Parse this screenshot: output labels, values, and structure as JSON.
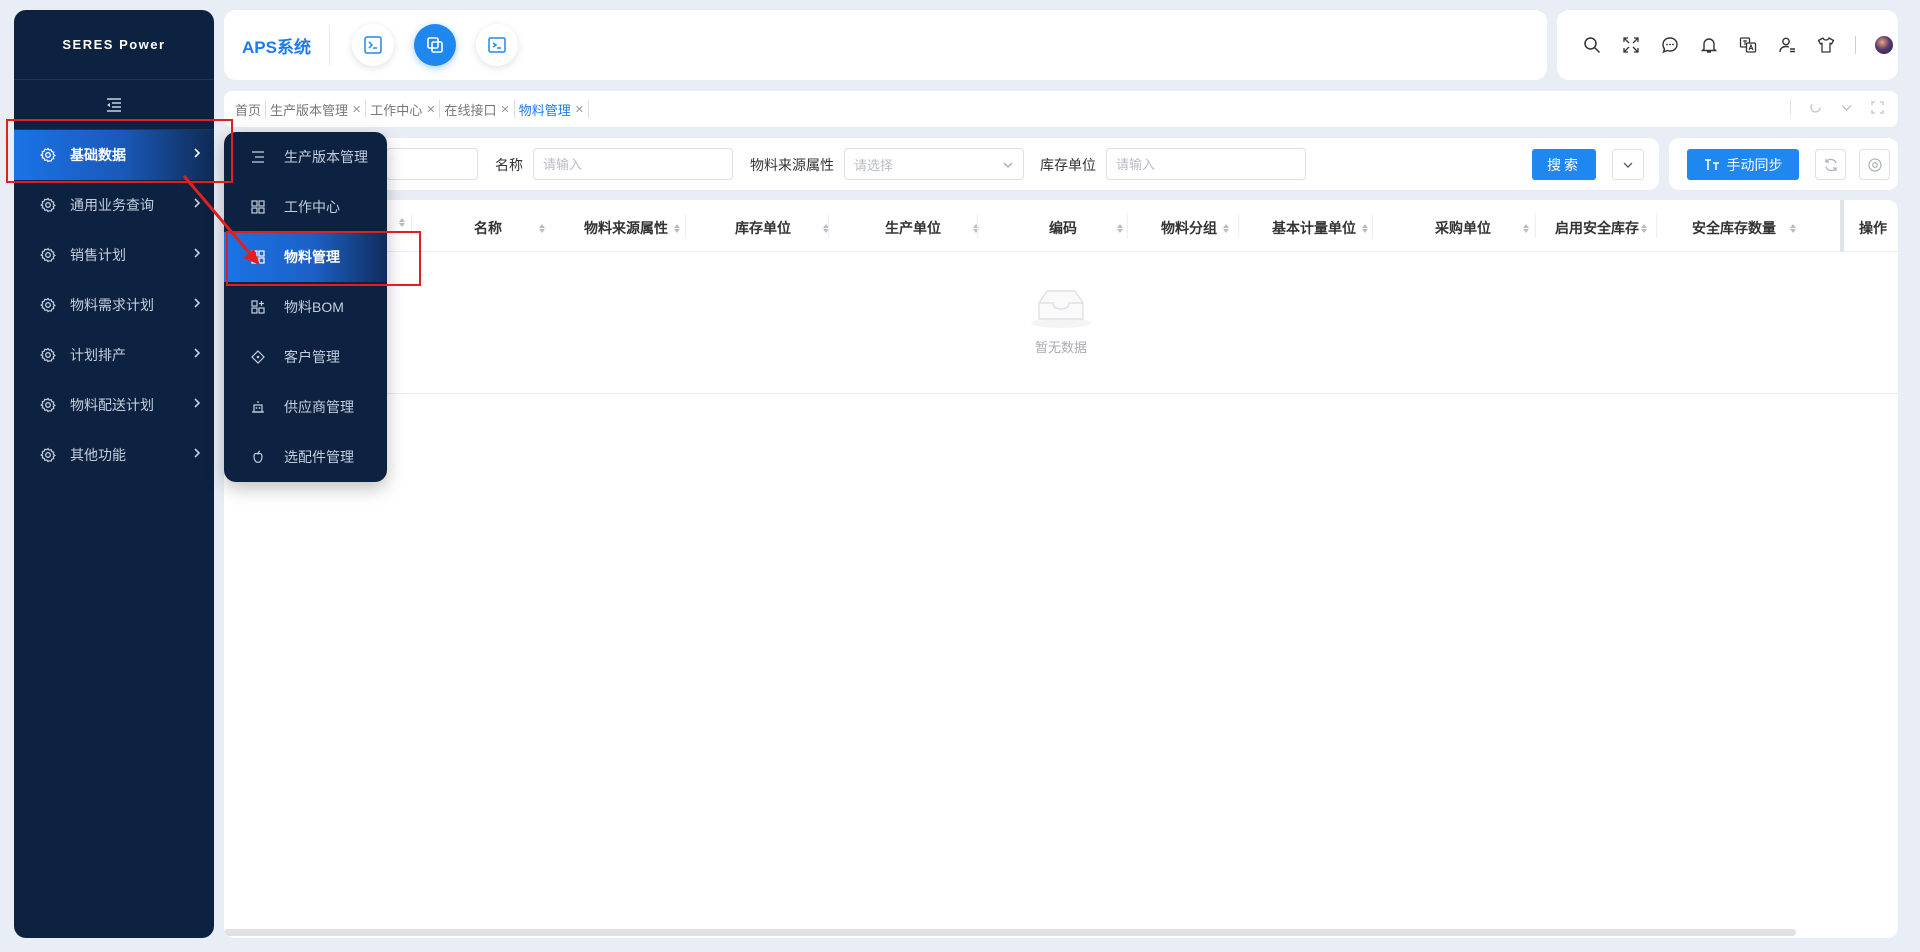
{
  "brand": {
    "logo_text": "SERES Power",
    "app_title": "APS系统"
  },
  "sidebar": {
    "items": [
      {
        "label": "基础数据",
        "icon": "gear-icon",
        "active": true
      },
      {
        "label": "通用业务查询",
        "icon": "gear-icon"
      },
      {
        "label": "销售计划",
        "icon": "gear-icon"
      },
      {
        "label": "物料需求计划",
        "icon": "gear-icon"
      },
      {
        "label": "计划排产",
        "icon": "gear-icon"
      },
      {
        "label": "物料配送计划",
        "icon": "gear-icon"
      },
      {
        "label": "其他功能",
        "icon": "gear-icon"
      }
    ]
  },
  "submenu": {
    "items": [
      {
        "label": "生产版本管理",
        "icon": "list-icon"
      },
      {
        "label": "工作中心",
        "icon": "grid-icon"
      },
      {
        "label": "物料管理",
        "icon": "grid-icon",
        "active": true
      },
      {
        "label": "物料BOM",
        "icon": "grid-plus-icon"
      },
      {
        "label": "客户管理",
        "icon": "diamond-icon"
      },
      {
        "label": "供应商管理",
        "icon": "robot-icon"
      },
      {
        "label": "选配件管理",
        "icon": "apple-icon"
      }
    ]
  },
  "tabs": [
    {
      "label": "首页",
      "closable": false
    },
    {
      "label": "生产版本管理",
      "closable": true
    },
    {
      "label": "工作中心",
      "closable": true
    },
    {
      "label": "在线接口",
      "closable": true
    },
    {
      "label": "物料管理",
      "closable": true,
      "active": true
    }
  ],
  "filters": {
    "name_label": "名称",
    "name_placeholder": "请输入",
    "source_label": "物料来源属性",
    "source_placeholder": "请选择",
    "stock_unit_label": "库存单位",
    "stock_unit_placeholder": "请输入",
    "search_button": "搜索"
  },
  "actions": {
    "sync_button": "手动同步"
  },
  "table": {
    "columns": [
      "名称",
      "物料来源属性",
      "库存单位",
      "生产单位",
      "编码",
      "物料分组",
      "基本计量单位",
      "采购单位",
      "启用安全库存",
      "安全库存数量",
      "操作"
    ],
    "empty_text": "暂无数据"
  },
  "colors": {
    "primary": "#1e88f0",
    "sidebar_bg": "#0d2240",
    "annotation": "#e02020"
  }
}
